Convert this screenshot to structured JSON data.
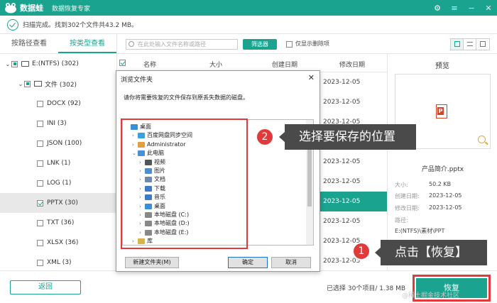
{
  "app": {
    "name": "数据蛙",
    "subtitle": "数据恢复专家",
    "window_controls": [
      "⚙",
      "≡",
      "−",
      "✕"
    ]
  },
  "status": {
    "text": "扫描完成。找到302个文件共43.2 MB。"
  },
  "left_panel": {
    "tabs": [
      "按路径查看",
      "按类型查看"
    ],
    "active_tab": 1,
    "tree": [
      {
        "label": "E:(NTFS) (302)",
        "level": 0,
        "state": "partial",
        "expanded": true
      },
      {
        "label": "文件 (302)",
        "level": 1,
        "state": "partial",
        "expanded": true
      },
      {
        "label": "DOCX (92)",
        "level": 2,
        "state": "unchecked"
      },
      {
        "label": "INI (3)",
        "level": 2,
        "state": "unchecked"
      },
      {
        "label": "JSON (100)",
        "level": 2,
        "state": "unchecked"
      },
      {
        "label": "LNK (1)",
        "level": 2,
        "state": "unchecked"
      },
      {
        "label": "LOG (1)",
        "level": 2,
        "state": "unchecked"
      },
      {
        "label": "PPTX (30)",
        "level": 2,
        "state": "checked",
        "selected": true
      },
      {
        "label": "TXT (36)",
        "level": 2,
        "state": "unchecked"
      },
      {
        "label": "XLSX (36)",
        "level": 2,
        "state": "unchecked"
      },
      {
        "label": "XML (3)",
        "level": 2,
        "state": "unchecked"
      }
    ]
  },
  "toolbar": {
    "search_placeholder": "在此处输入文件名称或路径",
    "filter_label": "筛选器",
    "only_deleted_label": "仅显示删除项"
  },
  "table": {
    "headers": [
      "名称",
      "大小",
      "创建日期",
      "修改日期"
    ],
    "modified_dates": [
      "2023-12-05",
      "2023-12-05",
      "2023-12-05",
      "2023-12-05",
      "2023-12-05",
      "2023-12-05",
      "2023-12-05",
      "2023-12-05",
      "2023-12-05",
      "2023-12-05"
    ],
    "highlighted_row": 6
  },
  "preview": {
    "title": "预览",
    "file_name": "产品简介.pptx",
    "size_label": "大小:",
    "size_value": "50.2 KB",
    "created_label": "创建日期:",
    "created_value": "2023-12-05",
    "modified_label": "修改日期:",
    "modified_value": "2023-12-05",
    "path_label": "路径:",
    "path_value": "E:(NTFS)\\素材\\PPT"
  },
  "bottom": {
    "back_label": "返回",
    "selection_info": "已选择 30个项目/ 1.38 MB",
    "recover_label": "恢复",
    "watermark": "@稀土掘金技术社区"
  },
  "dialog": {
    "title": "浏览文件夹",
    "message": "请你将需要恢复的文件保存到原丢失数据的磁盘。",
    "folders": [
      {
        "label": "桌面",
        "level": 0,
        "arrow": "",
        "icon": "desktop-folder-icon"
      },
      {
        "label": "百度网盘同步空间",
        "level": 1,
        "arrow": "›",
        "icon": "cloud-icon"
      },
      {
        "label": "Administrator",
        "level": 1,
        "arrow": "›",
        "icon": "user-icon"
      },
      {
        "label": "此电脑",
        "level": 1,
        "arrow": "⌄",
        "icon": "computer-icon"
      },
      {
        "label": "视频",
        "level": 2,
        "arrow": "›",
        "icon": "video-icon"
      },
      {
        "label": "图片",
        "level": 2,
        "arrow": "›",
        "icon": "picture-icon"
      },
      {
        "label": "文档",
        "level": 2,
        "arrow": "›",
        "icon": "document-icon"
      },
      {
        "label": "下载",
        "level": 2,
        "arrow": "›",
        "icon": "download-icon"
      },
      {
        "label": "音乐",
        "level": 2,
        "arrow": "›",
        "icon": "music-icon"
      },
      {
        "label": "桌面",
        "level": 2,
        "arrow": "›",
        "icon": "desktop-folder-icon"
      },
      {
        "label": "本地磁盘 (C:)",
        "level": 2,
        "arrow": "›",
        "icon": "disk-icon"
      },
      {
        "label": "本地磁盘 (D:)",
        "level": 2,
        "arrow": "›",
        "icon": "disk-icon"
      },
      {
        "label": "本地磁盘 (E:)",
        "level": 2,
        "arrow": "›",
        "icon": "disk-icon"
      },
      {
        "label": "库",
        "level": 1,
        "arrow": "›",
        "icon": "library-icon"
      }
    ],
    "new_folder_label": "新建文件夹(M)",
    "ok_label": "确定",
    "cancel_label": "取消"
  },
  "annotations": {
    "step1_number": "1",
    "step1_text": "点击【恢复】",
    "step2_number": "2",
    "step2_text": "选择要保存的位置"
  },
  "colors": {
    "accent": "#1aa38f",
    "annotation_red": "#e03a3a",
    "callout_bg": "#4a4a4a"
  }
}
